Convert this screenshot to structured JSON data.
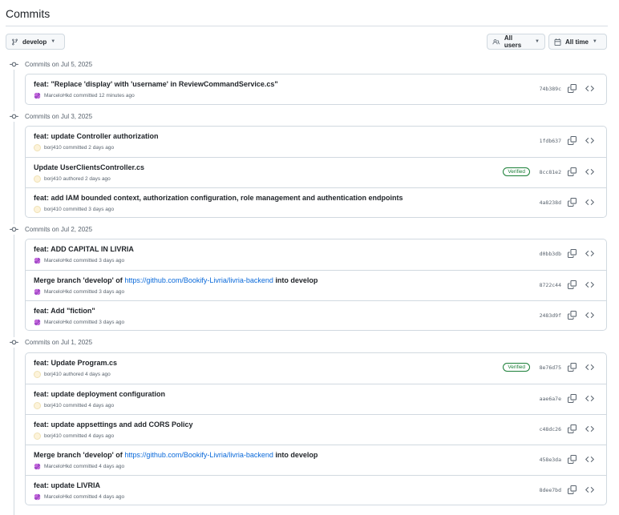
{
  "header": {
    "title": "Commits"
  },
  "toolbar": {
    "branch_label": "develop",
    "users_label": "All users",
    "time_label": "All time"
  },
  "groups": [
    {
      "heading": "Commits on Jul 5, 2025",
      "commits": [
        {
          "message": "feat: \"Replace 'display' with 'username' in ReviewCommandService.cs\"",
          "author": "MarceloHkd",
          "action": "committed",
          "when": "12 minutes ago",
          "sha": "74b389c",
          "verified": false,
          "avatar": "m"
        }
      ]
    },
    {
      "heading": "Commits on Jul 3, 2025",
      "commits": [
        {
          "message": "feat: update Controller authorization",
          "author": "borj410",
          "action": "committed",
          "when": "2 days ago",
          "sha": "1fdb637",
          "verified": false,
          "avatar": "b"
        },
        {
          "message": "Update UserClientsController.cs",
          "author": "borj410",
          "action": "authored",
          "when": "2 days ago",
          "sha": "8cc81e2",
          "verified": true,
          "avatar": "b"
        },
        {
          "message": "feat: add IAM bounded context, authorization configuration, role management and authentication endpoints",
          "author": "borj410",
          "action": "committed",
          "when": "3 days ago",
          "sha": "4a8238d",
          "verified": false,
          "avatar": "b"
        }
      ]
    },
    {
      "heading": "Commits on Jul 2, 2025",
      "commits": [
        {
          "message": "feat: ADD CAPITAL IN LIVRIA",
          "author": "MarceloHkd",
          "action": "committed",
          "when": "3 days ago",
          "sha": "d0bb3db",
          "verified": false,
          "avatar": "m"
        },
        {
          "message_prefix": "Merge branch 'develop' of ",
          "link": "https://github.com/Bookify-Livria/livria-backend",
          "message_suffix": " into develop",
          "author": "MarceloHkd",
          "action": "committed",
          "when": "3 days ago",
          "sha": "8722c44",
          "verified": false,
          "avatar": "m"
        },
        {
          "message": "feat: Add \"fiction\"",
          "author": "MarceloHkd",
          "action": "committed",
          "when": "3 days ago",
          "sha": "2483d9f",
          "verified": false,
          "avatar": "m"
        }
      ]
    },
    {
      "heading": "Commits on Jul 1, 2025",
      "commits": [
        {
          "message": "feat: Update Program.cs",
          "author": "borj410",
          "action": "authored",
          "when": "4 days ago",
          "sha": "8e76d75",
          "verified": true,
          "avatar": "b"
        },
        {
          "message": "feat: update deployment configuration",
          "author": "borj410",
          "action": "committed",
          "when": "4 days ago",
          "sha": "aae6a7e",
          "verified": false,
          "avatar": "b"
        },
        {
          "message": "feat: update appsettings and add CORS Policy",
          "author": "borj410",
          "action": "committed",
          "when": "4 days ago",
          "sha": "c48dc26",
          "verified": false,
          "avatar": "b"
        },
        {
          "message_prefix": "Merge branch 'develop' of ",
          "link": "https://github.com/Bookify-Livria/livria-backend",
          "message_suffix": " into develop",
          "author": "MarceloHkd",
          "action": "committed",
          "when": "4 days ago",
          "sha": "458e3da",
          "verified": false,
          "avatar": "m"
        },
        {
          "message": "feat: update LIVRIA",
          "author": "MarceloHkd",
          "action": "committed",
          "when": "4 days ago",
          "sha": "8dee7bd",
          "verified": false,
          "avatar": "m"
        }
      ]
    }
  ],
  "verified_label": "Verified",
  "icons": {
    "branch": "git-branch-icon",
    "people": "people-icon",
    "calendar": "calendar-icon",
    "commit": "git-commit-icon",
    "copy": "copy-icon",
    "code": "code-icon"
  },
  "colors": {
    "link": "#0969da",
    "verified": "#1a7f37",
    "border": "#d1d9e0",
    "muted": "#59636e"
  }
}
